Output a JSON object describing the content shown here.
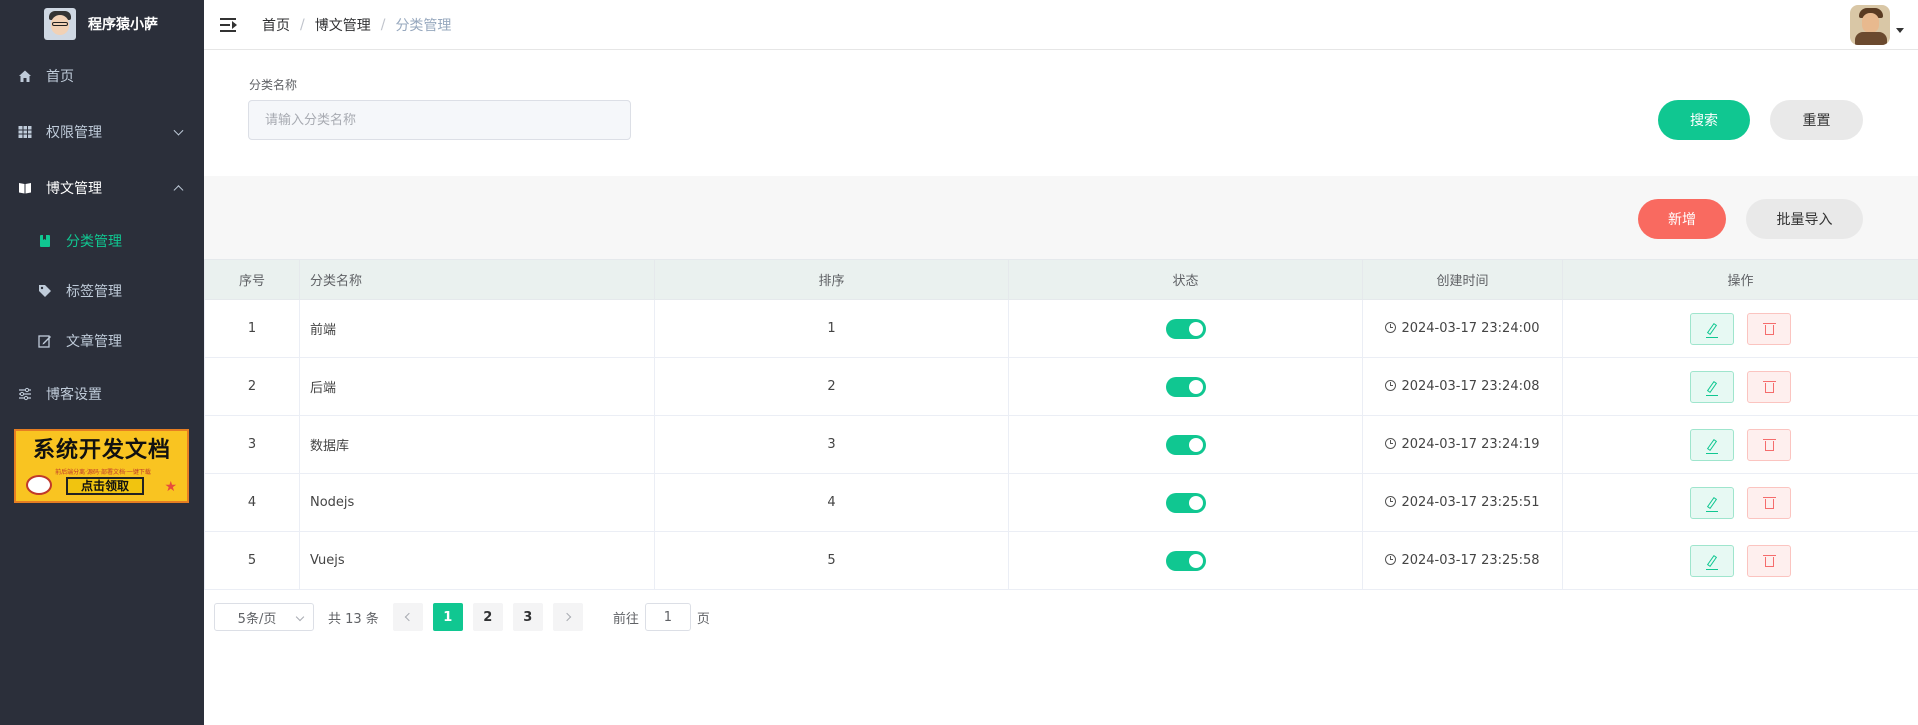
{
  "app": {
    "title": "程序猿小萨"
  },
  "sidebar": {
    "items": [
      {
        "label": "首页",
        "icon": "home-icon"
      },
      {
        "label": "权限管理",
        "icon": "grid-icon"
      },
      {
        "label": "博文管理",
        "icon": "book-icon"
      },
      {
        "label": "分类管理",
        "icon": "bookmark-icon"
      },
      {
        "label": "标签管理",
        "icon": "tag-icon"
      },
      {
        "label": "文章管理",
        "icon": "edit-icon"
      },
      {
        "label": "博客设置",
        "icon": "sliders-icon"
      }
    ],
    "banner": {
      "title": "系统开发文档",
      "subtitle": "前后端分离·源码·部署文档·一键下载",
      "button": "点击领取"
    }
  },
  "breadcrumb": [
    "首页",
    "博文管理",
    "分类管理"
  ],
  "search": {
    "label": "分类名称",
    "placeholder": "请输入分类名称",
    "value": "",
    "search_button": "搜索",
    "reset_button": "重置"
  },
  "toolbar": {
    "add_button": "新增",
    "import_button": "批量导入"
  },
  "table": {
    "headers": [
      "序号",
      "分类名称",
      "排序",
      "状态",
      "创建时间",
      "操作"
    ],
    "rows": [
      {
        "index": "1",
        "name": "前端",
        "sort": "1",
        "status": true,
        "created": "2024-03-17 23:24:00"
      },
      {
        "index": "2",
        "name": "后端",
        "sort": "2",
        "status": true,
        "created": "2024-03-17 23:24:08"
      },
      {
        "index": "3",
        "name": "数据库",
        "sort": "3",
        "status": true,
        "created": "2024-03-17 23:24:19"
      },
      {
        "index": "4",
        "name": "Nodejs",
        "sort": "4",
        "status": true,
        "created": "2024-03-17 23:25:51"
      },
      {
        "index": "5",
        "name": "Vuejs",
        "sort": "5",
        "status": true,
        "created": "2024-03-17 23:25:58"
      }
    ]
  },
  "pagination": {
    "page_size": "5条/页",
    "total": "共 13 条",
    "pages": [
      "1",
      "2",
      "3"
    ],
    "current": "1",
    "goto_prefix": "前往",
    "goto_value": "1",
    "goto_suffix": "页"
  },
  "colors": {
    "accent": "#10c791",
    "danger": "#f96a60",
    "sidebar_bg": "#2b2f3a"
  }
}
